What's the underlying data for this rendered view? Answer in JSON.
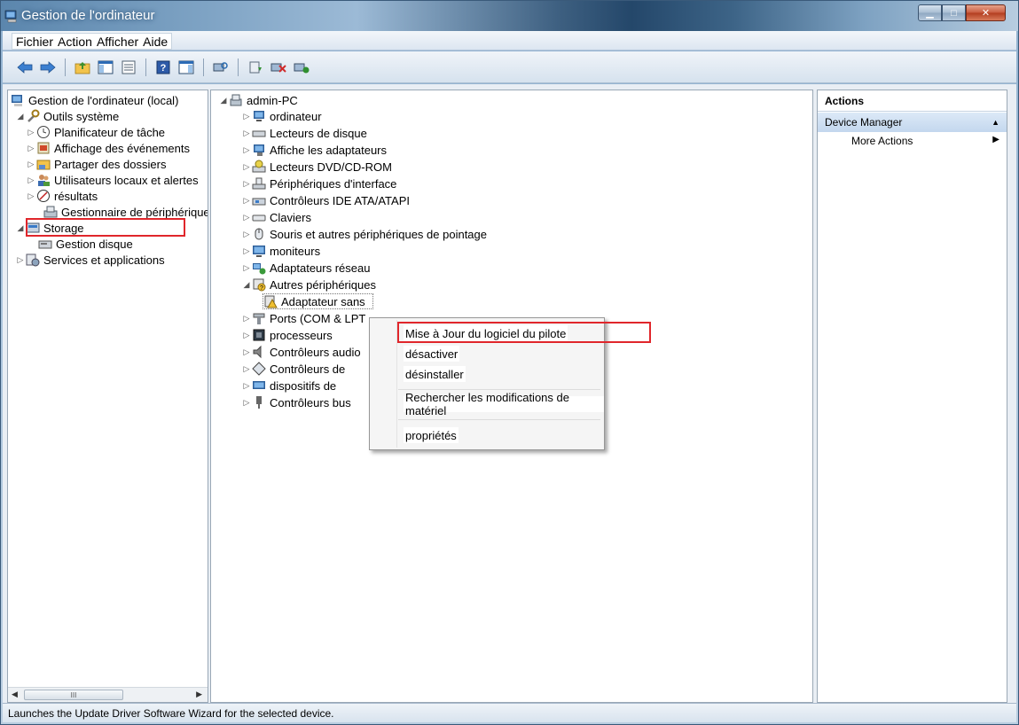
{
  "window": {
    "title": "Gestion de l'ordinateur"
  },
  "menubar": {
    "items": [
      "Fichier",
      "Action",
      "Afficher",
      "Aide"
    ]
  },
  "left_tree": [
    "Gestion de l'ordinateur (local)",
    "Outils système",
    "Planificateur de tâche",
    "Affichage des événements",
    "Partager des dossiers",
    "Utilisateurs locaux et alertes",
    "résultats",
    "Gestionnaire de périphériques",
    "Storage",
    "Gestion disque",
    "Services et applications"
  ],
  "device_tree": [
    "admin-PC",
    "ordinateur",
    "Lecteurs de disque",
    "Affiche les adaptateurs",
    "Lecteurs DVD/CD-ROM",
    "Périphériques d'interface",
    "Contrôleurs IDE ATA/ATAPI",
    "Claviers",
    "Souris et autres périphériques de pointage",
    "moniteurs",
    "Adaptateurs réseau",
    "Autres périphériques",
    "Adaptateur sans",
    "Ports (COM & LPT",
    "processeurs",
    "Contrôleurs audio",
    "Contrôleurs de",
    "dispositifs de",
    "Contrôleurs bus"
  ],
  "context_menu": {
    "update": "Mise à Jour du logiciel du pilote",
    "disable": "désactiver",
    "uninstall": "désinstaller",
    "scan": "Rechercher les modifications de matériel",
    "properties": "propriétés"
  },
  "actions_pane": {
    "header": "Actions",
    "section": "Device Manager",
    "more": "More Actions"
  },
  "scrollbar": {
    "thumb_glyph": "III"
  },
  "statusbar": {
    "text": "Launches the Update Driver Software Wizard for the selected device."
  },
  "colors": {
    "highlight_red": "#e0262b",
    "title_text": "#ffffff"
  }
}
